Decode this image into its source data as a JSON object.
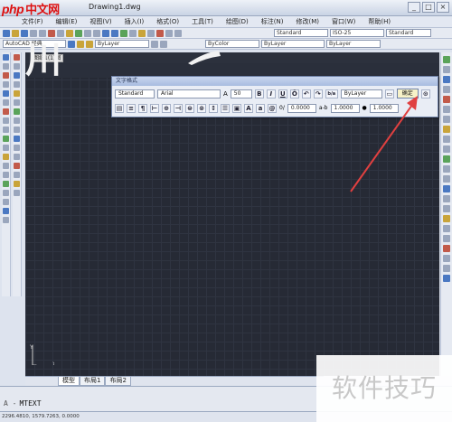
{
  "brand": {
    "logo": "php",
    "logo_cn": "中文网"
  },
  "window": {
    "title": "Drawing1.dwg",
    "btn_min": "_",
    "btn_max": "□",
    "btn_close": "×"
  },
  "menu": [
    "文件(F)",
    "编辑(E)",
    "视图(V)",
    "插入(I)",
    "格式(O)",
    "工具(T)",
    "绘图(D)",
    "标注(N)",
    "修改(M)",
    "窗口(W)",
    "帮助(H)"
  ],
  "toolbar": {
    "workspace": "AutoCAD 经典",
    "style_text": "Standard",
    "dim_style": "ISO-25",
    "table_style": "Standard",
    "layer_combo": "ByLayer",
    "linetype_combo": "ByLayer",
    "lineweight_combo": "ByLayer",
    "color_combo": "ByColor"
  },
  "canvas": {
    "label": "图纸1(1)图",
    "glyph": "川"
  },
  "text_format": {
    "title": "文字格式",
    "style": "Standard",
    "font": "Arial",
    "height_symbol": "A",
    "height": "50",
    "bold": "B",
    "italic": "I",
    "underline": "U",
    "overline": "Ō",
    "undo": "↶",
    "redo": "↷",
    "stack": "b/a",
    "color": "ByLayer",
    "ruler": "▭",
    "ok_label": "确定",
    "options": "⊙",
    "oblique_label": "0/",
    "oblique_value": "0.0000",
    "tracking_label": "a-b",
    "tracking_value": "1.0000",
    "width_label": "●",
    "width_value": "1.0000"
  },
  "tabs": [
    "模型",
    "布局1",
    "布局2"
  ],
  "command": {
    "prefix": "A -",
    "text": "MTEXT"
  },
  "status": {
    "text": "2296.4810, 1579.7263, 0.0000"
  },
  "watermark": "软件技巧",
  "arrow_color": "#e04040"
}
